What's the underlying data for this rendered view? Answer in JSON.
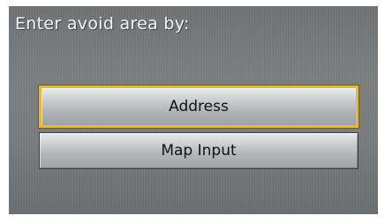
{
  "screen": {
    "title": "Enter avoid area by:",
    "options": [
      {
        "label": "Address",
        "selected": true
      },
      {
        "label": "Map Input",
        "selected": false
      }
    ],
    "colors": {
      "background": "#7a7d7f",
      "title_text": "#f4f4f4",
      "selection_border": "#e6b93c",
      "button_text": "#111111"
    }
  }
}
